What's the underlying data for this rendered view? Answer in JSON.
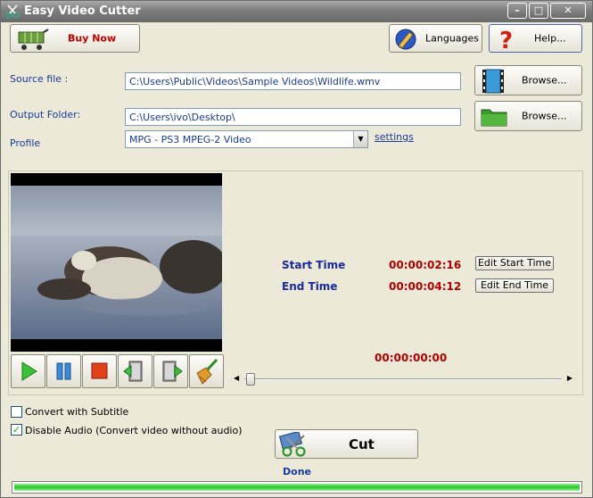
{
  "window": {
    "title": "Easy Video Cutter",
    "controls": [
      "minimize",
      "maximize",
      "close"
    ]
  },
  "toolbar": {
    "buy_now_label": "Buy Now",
    "languages_label": "Languages",
    "help_label": "Help..."
  },
  "source": {
    "label": "Source file :",
    "value": "C:\\Users\\Public\\Videos\\Sample Videos\\Wildlife.wmv",
    "browse_label": "Browse..."
  },
  "output": {
    "label": "Output Folder:",
    "value": "C:\\Users\\ivo\\Desktop\\",
    "browse_label": "Browse..."
  },
  "profile": {
    "label": "Profile",
    "selected": "MPG - PS3 MPEG-2 Video",
    "settings_link": "settings"
  },
  "timing": {
    "start_label": "Start Time",
    "start_value": "00:00:02:16",
    "end_label": "End Time",
    "end_value": "00:00:04:12",
    "edit_start_label": "Edit Start Time",
    "edit_end_label": "Edit End Time",
    "current_value": "00:00:00:00"
  },
  "player": {
    "position_fraction": 0.0
  },
  "options": {
    "subtitle_label": "Convert with Subtitle",
    "subtitle_checked": false,
    "disable_audio_label": "Disable Audio (Convert video without audio)",
    "disable_audio_checked": true
  },
  "cut": {
    "label": "Cut",
    "status": "Done",
    "progress": 1.0
  },
  "colors": {
    "accent_blue": "#1a3a9a",
    "time_red": "#b00000",
    "progress_green": "#28c428"
  }
}
